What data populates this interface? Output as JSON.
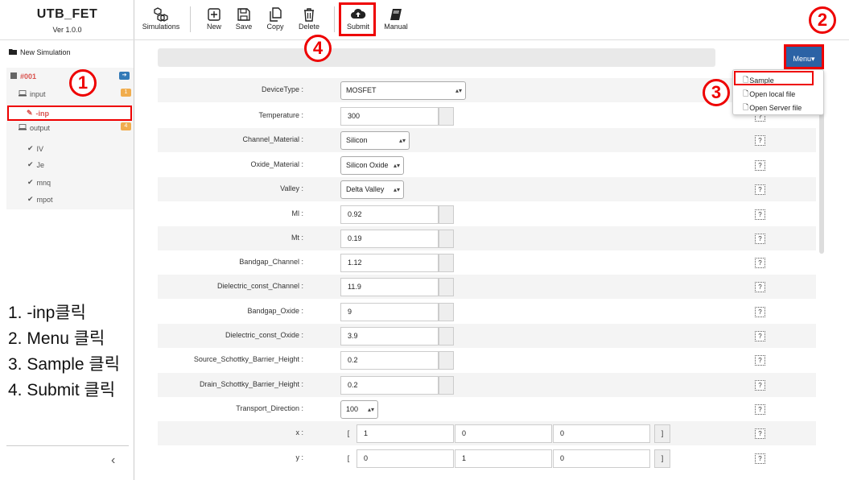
{
  "app": {
    "title": "UTB_FET",
    "version": "Ver 1.0.0"
  },
  "toolbar": {
    "simulations": "Simulations",
    "new": "New",
    "save": "Save",
    "copy": "Copy",
    "delete": "Delete",
    "submit": "Submit",
    "manual": "Manual"
  },
  "sidebar": {
    "new_simulation": "New Simulation",
    "sim_id": "#001",
    "input_label": "input",
    "input_badge": "1",
    "selected_item": "-inp",
    "output_label": "output",
    "output_badge": "4",
    "outputs": [
      "IV",
      "Je",
      "mnq",
      "mpot"
    ],
    "collapse": "‹"
  },
  "menu": {
    "button": "Menu▾",
    "items": [
      "Sample",
      "Open local file",
      "Open Server file"
    ]
  },
  "instructions": [
    "1. -inp클릭",
    "2. Menu 클릭",
    "3. Sample 클릭",
    "4. Submit 클릭"
  ],
  "markers": [
    "1",
    "2",
    "3",
    "4"
  ],
  "help": "?",
  "form": {
    "device_type": {
      "label": "DeviceType :",
      "value": "MOSFET"
    },
    "temperature": {
      "label": "Temperature :",
      "value": "300"
    },
    "channel_material": {
      "label": "Channel_Material :",
      "value": "Silicon"
    },
    "oxide_material": {
      "label": "Oxide_Material :",
      "value": "Silicon Oxide"
    },
    "valley": {
      "label": "Valley :",
      "value": "Delta Valley"
    },
    "ml": {
      "label": "Ml :",
      "value": "0.92"
    },
    "mt": {
      "label": "Mt :",
      "value": "0.19"
    },
    "bandgap_channel": {
      "label": "Bandgap_Channel :",
      "value": "1.12"
    },
    "dielectric_channel": {
      "label": "Dielectric_const_Channel :",
      "value": "11.9"
    },
    "bandgap_oxide": {
      "label": "Bandgap_Oxide :",
      "value": "9"
    },
    "dielectric_oxide": {
      "label": "Dielectric_const_Oxide :",
      "value": "3.9"
    },
    "source_barrier": {
      "label": "Source_Schottky_Barrier_Height :",
      "value": "0.2"
    },
    "drain_barrier": {
      "label": "Drain_Schottky_Barrier_Height :",
      "value": "0.2"
    },
    "transport_direction": {
      "label": "Transport_Direction :",
      "value": "100"
    },
    "x": {
      "label": "x :",
      "open": "[",
      "close": "]",
      "values": [
        "1",
        "0",
        "0"
      ]
    },
    "y": {
      "label": "y :",
      "open": "[",
      "close": "]",
      "values": [
        "0",
        "1",
        "0"
      ]
    }
  }
}
